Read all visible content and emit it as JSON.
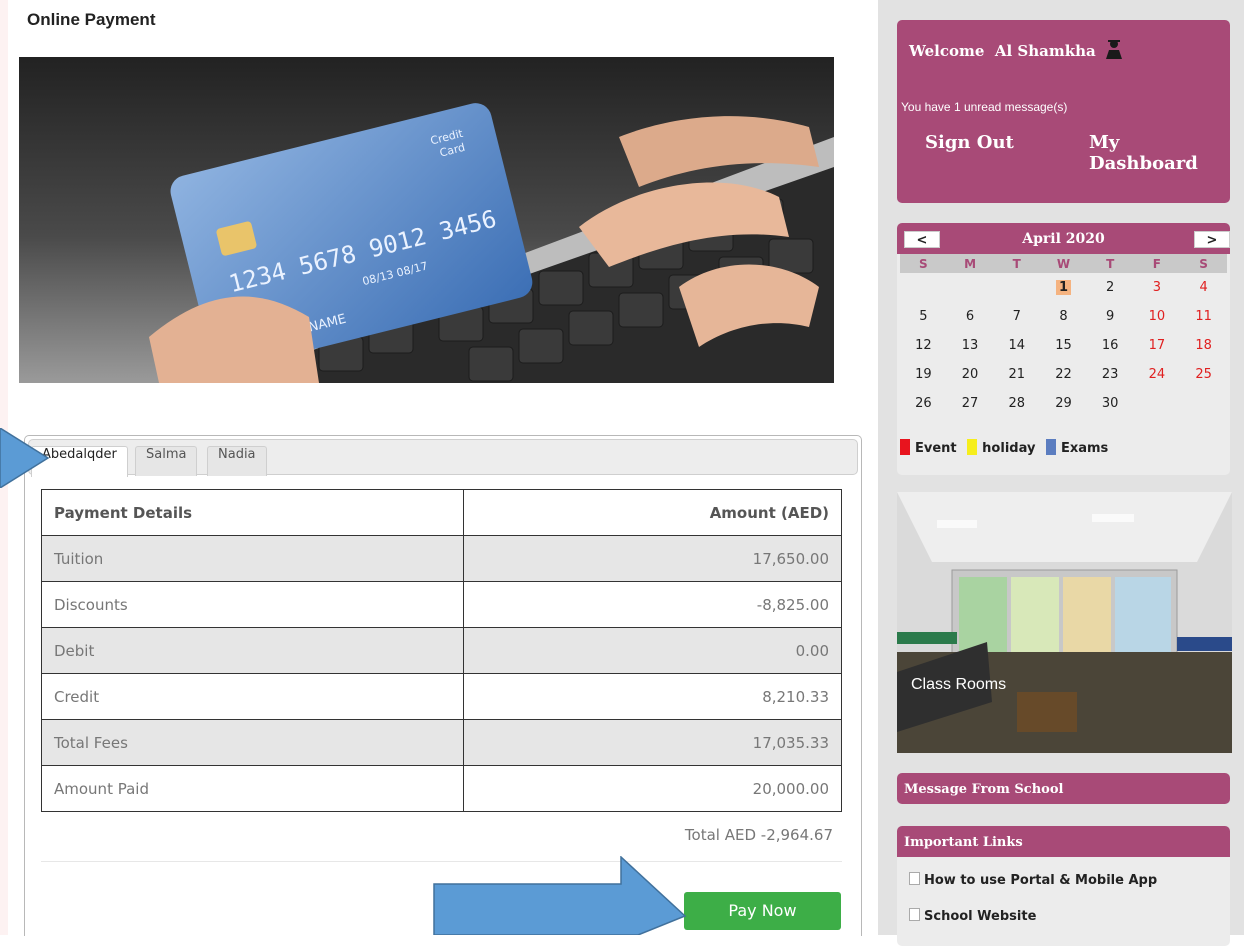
{
  "page": {
    "title": "Online Payment"
  },
  "tabs": [
    {
      "label": "Abedalqder",
      "active": true
    },
    {
      "label": "Salma",
      "active": false
    },
    {
      "label": "Nadia",
      "active": false
    }
  ],
  "payment_table": {
    "headers": [
      "Payment Details",
      "Amount (AED)"
    ],
    "rows": [
      {
        "label": "Tuition",
        "amount": "17,650.00"
      },
      {
        "label": "Discounts",
        "amount": "-8,825.00"
      },
      {
        "label": "Debit",
        "amount": "0.00"
      },
      {
        "label": "Credit",
        "amount": "8,210.33"
      },
      {
        "label": "Total Fees",
        "amount": "17,035.33"
      },
      {
        "label": "Amount Paid",
        "amount": "20,000.00"
      }
    ],
    "total": "Total AED -2,964.67"
  },
  "pay_button": "Pay Now",
  "welcome": {
    "greeting": "Welcome",
    "name": "Al Shamkha",
    "unread": "You have 1 unread message(s)",
    "sign_out": "Sign Out",
    "dashboard": "My Dashboard"
  },
  "calendar": {
    "prev": "<",
    "next": ">",
    "title": "April 2020",
    "weekdays": [
      "S",
      "M",
      "T",
      "W",
      "T",
      "F",
      "S"
    ],
    "weeks": [
      [
        "",
        "",
        "",
        "1",
        "2",
        "3",
        "4"
      ],
      [
        "5",
        "6",
        "7",
        "8",
        "9",
        "10",
        "11"
      ],
      [
        "12",
        "13",
        "14",
        "15",
        "16",
        "17",
        "18"
      ],
      [
        "19",
        "20",
        "21",
        "22",
        "23",
        "24",
        "25"
      ],
      [
        "26",
        "27",
        "28",
        "29",
        "30",
        "",
        ""
      ]
    ],
    "today": "1",
    "legend": [
      {
        "label": "Event",
        "color": "#e8141e"
      },
      {
        "label": "holiday",
        "color": "#f6ee1c"
      },
      {
        "label": "Exams",
        "color": "#5b7dc0"
      }
    ]
  },
  "photo": {
    "caption": "Class Rooms"
  },
  "message_bar": "Message From School",
  "links": {
    "title": "Important Links",
    "items": [
      "How to use Portal & Mobile App",
      "School Website"
    ]
  },
  "colors": {
    "brand": "#a84a77",
    "pay_button": "#3dae47",
    "arrow": "#5b9bd5"
  }
}
